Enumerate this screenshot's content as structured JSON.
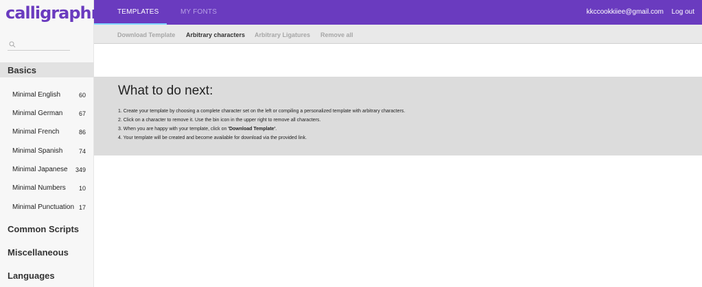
{
  "app": {
    "logo_text": "calligraphr"
  },
  "topbar": {
    "tabs": [
      {
        "label": "TEMPLATES",
        "active": true
      },
      {
        "label": "MY FONTS",
        "active": false
      }
    ],
    "user_email": "kkccookkiiee@gmail.com",
    "logout_label": "Log out",
    "accent": "#6a3bbf"
  },
  "subbar": {
    "items": [
      {
        "label": "Download Template"
      },
      {
        "label": "Arbitrary characters"
      },
      {
        "label": "Arbitrary Ligatures"
      },
      {
        "label": "Remove all"
      }
    ]
  },
  "sidebar": {
    "search": {
      "placeholder": ""
    },
    "sections": [
      {
        "label": "Basics"
      },
      {
        "label": "Common Scripts"
      },
      {
        "label": "Miscellaneous"
      },
      {
        "label": "Languages"
      }
    ],
    "items": [
      {
        "label": "Minimal English",
        "count": "60"
      },
      {
        "label": "Minimal German",
        "count": "67"
      },
      {
        "label": "Minimal French",
        "count": "86"
      },
      {
        "label": "Minimal Spanish",
        "count": "74"
      },
      {
        "label": "Minimal Japanese",
        "count": "349"
      },
      {
        "label": "Minimal Numbers",
        "count": "10"
      },
      {
        "label": "Minimal Punctuation",
        "count": "17"
      }
    ]
  },
  "panel": {
    "title": "What to do next:",
    "steps": [
      "1. Create your template by choosing a complete character set on the left or compiling a personalized template with arbitrary characters.",
      "2. Click on a character to remove it. Use the bin icon in the upper right to remove all characters.",
      "3. When you are happy with your template, click on ",
      "4. Your template will be created and become available for download via the provided link."
    ],
    "step3_bold": "'Download Template'",
    "step3_end": "."
  }
}
